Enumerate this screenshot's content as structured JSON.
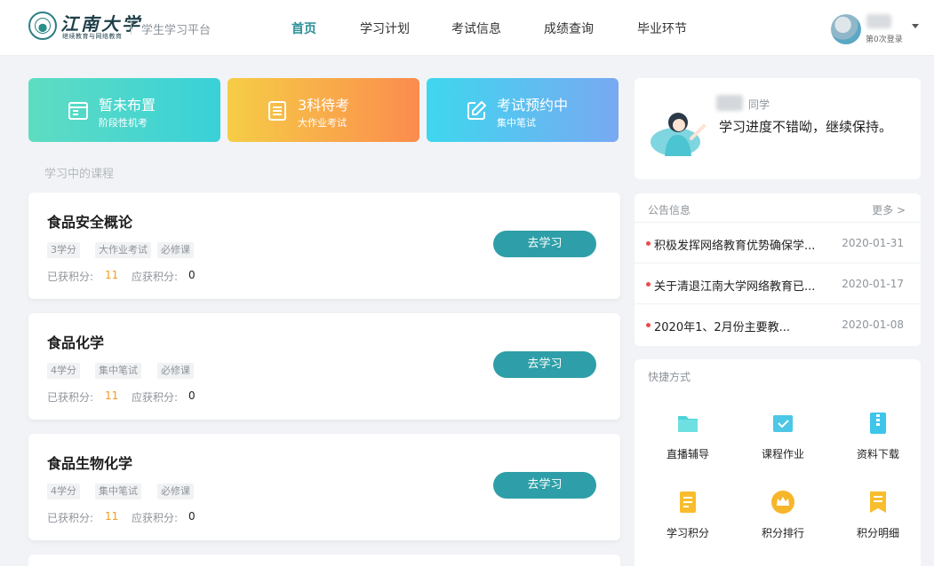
{
  "header": {
    "logo_name": "江南大学",
    "logo_sub": "继续教育与网络教育",
    "platform_title": "学生学习平台",
    "nav": [
      {
        "label": "首页",
        "active": true
      },
      {
        "label": "学习计划",
        "active": false
      },
      {
        "label": "考试信息",
        "active": false
      },
      {
        "label": "成绩查询",
        "active": false
      },
      {
        "label": "毕业环节",
        "active": false
      }
    ],
    "user": {
      "login_count": "第0次登录"
    }
  },
  "status_cards": [
    {
      "title": "暂未布置",
      "subtitle": "阶段性机考",
      "icon": "calendar-icon"
    },
    {
      "title": "3科待考",
      "subtitle": "大作业考试",
      "icon": "document-list-icon"
    },
    {
      "title": "考试预约中",
      "subtitle": "集中笔试",
      "icon": "edit-icon"
    }
  ],
  "section_label": "学习中的课程",
  "courses": [
    {
      "name": "食品安全概论",
      "tags": [
        "3学分",
        "大作业考试",
        "必修课"
      ],
      "earned_label": "已获积分:",
      "earned": "11",
      "due_label": "应获积分:",
      "due": "0",
      "button": "去学习"
    },
    {
      "name": "食品化学",
      "tags": [
        "4学分",
        "集中笔试",
        "必修课"
      ],
      "earned_label": "已获积分:",
      "earned": "11",
      "due_label": "应获积分:",
      "due": "0",
      "button": "去学习"
    },
    {
      "name": "食品生物化学",
      "tags": [
        "4学分",
        "集中笔试",
        "必修课"
      ],
      "earned_label": "已获积分:",
      "earned": "11",
      "due_label": "应获积分:",
      "due": "0",
      "button": "去学习"
    }
  ],
  "greeting": {
    "suffix": "同学",
    "message": "学习进度不错呦，继续保持。"
  },
  "notices": {
    "title": "公告信息",
    "more": "更多 >",
    "items": [
      {
        "text": "积极发挥网络教育优势确保学...",
        "date": "2020-01-31"
      },
      {
        "text": "关于清退江南大学网络教育已...",
        "date": "2020-01-17"
      },
      {
        "text": "2020年1、2月份主要教...",
        "date": "2020-01-08"
      }
    ]
  },
  "shortcuts": {
    "title": "快捷方式",
    "items": [
      {
        "label": "直播辅导",
        "icon": "live-folder-icon",
        "color": "#4cd3d8"
      },
      {
        "label": "课程作业",
        "icon": "homework-icon",
        "color": "#4cc7e6"
      },
      {
        "label": "资料下载",
        "icon": "zip-download-icon",
        "color": "#3ec5ea"
      },
      {
        "label": "学习积分",
        "icon": "notes-icon",
        "color": "#f7bd2d"
      },
      {
        "label": "积分排行",
        "icon": "crown-icon",
        "color": "#f7b52a"
      },
      {
        "label": "积分明细",
        "icon": "bookmark-list-icon",
        "color": "#f7be2d"
      }
    ]
  },
  "colors": {
    "accent": "#2e9fa8",
    "earned": "#f39b1c",
    "notice_dot": "#ef4b4b"
  }
}
